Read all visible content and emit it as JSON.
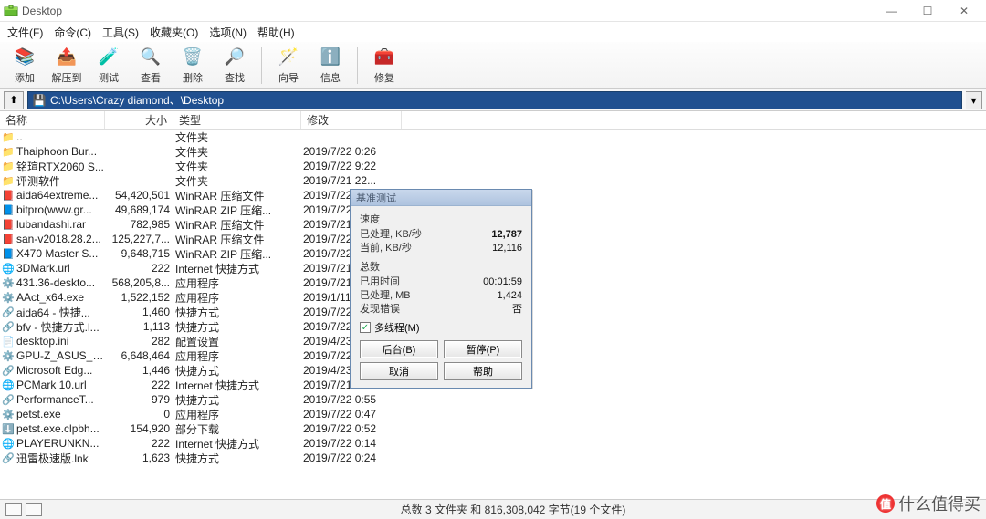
{
  "window": {
    "title": "Desktop"
  },
  "menu": {
    "file": "文件(F)",
    "cmd": "命令(C)",
    "tools": "工具(S)",
    "fav": "收藏夹(O)",
    "options": "选项(N)",
    "help": "帮助(H)"
  },
  "toolbar": {
    "add": "添加",
    "extract": "解压到",
    "test": "测试",
    "view": "查看",
    "delete": "删除",
    "find": "查找",
    "wizard": "向导",
    "info": "信息",
    "repair": "修复"
  },
  "address": {
    "path": "C:\\Users\\Crazy diamond、\\Desktop"
  },
  "columns": {
    "name": "名称",
    "size": "大小",
    "type": "类型",
    "modified": "修改"
  },
  "rows": [
    {
      "icon": "folder-up",
      "name": "..",
      "size": "",
      "type": "文件夹",
      "modified": ""
    },
    {
      "icon": "folder",
      "name": "Thaiphoon Bur...",
      "size": "",
      "type": "文件夹",
      "modified": "2019/7/22 0:26"
    },
    {
      "icon": "folder",
      "name": "铭瑄RTX2060 S...",
      "size": "",
      "type": "文件夹",
      "modified": "2019/7/22 9:22"
    },
    {
      "icon": "folder",
      "name": "评测软件",
      "size": "",
      "type": "文件夹",
      "modified": "2019/7/21 22..."
    },
    {
      "icon": "rar",
      "name": "aida64extreme...",
      "size": "54,420,501",
      "type": "WinRAR 压缩文件",
      "modified": "2019/7/22 0:32"
    },
    {
      "icon": "zip",
      "name": "bitpro(www.gr...",
      "size": "49,689,174",
      "type": "WinRAR ZIP 压缩...",
      "modified": "2019/7/22 0:59"
    },
    {
      "icon": "rar",
      "name": "lubandashi.rar",
      "size": "782,985",
      "type": "WinRAR 压缩文件",
      "modified": "2019/7/21 22..."
    },
    {
      "icon": "rar",
      "name": "san-v2018.28.2...",
      "size": "125,227,7...",
      "type": "WinRAR 压缩文件",
      "modified": "2019/7/22 0:47"
    },
    {
      "icon": "zip",
      "name": "X470 Master S...",
      "size": "9,648,715",
      "type": "WinRAR ZIP 压缩...",
      "modified": "2019/7/22 0:51"
    },
    {
      "icon": "url",
      "name": "3DMark.url",
      "size": "222",
      "type": "Internet 快捷方式",
      "modified": "2019/7/21 22..."
    },
    {
      "icon": "exe",
      "name": "431.36-deskto...",
      "size": "568,205,8...",
      "type": "应用程序",
      "modified": "2019/7/21 22..."
    },
    {
      "icon": "exe",
      "name": "AAct_x64.exe",
      "size": "1,522,152",
      "type": "应用程序",
      "modified": "2019/1/11 20..."
    },
    {
      "icon": "lnk",
      "name": "aida64 - 快捷...",
      "size": "1,460",
      "type": "快捷方式",
      "modified": "2019/7/22 20:33"
    },
    {
      "icon": "lnk",
      "name": "bfv - 快捷方式.l...",
      "size": "1,113",
      "type": "快捷方式",
      "modified": "2019/7/22 7:07"
    },
    {
      "icon": "ini",
      "name": "desktop.ini",
      "size": "282",
      "type": "配置设置",
      "modified": "2019/4/23 0:17"
    },
    {
      "icon": "exe",
      "name": "GPU-Z_ASUS_R...",
      "size": "6,648,464",
      "type": "应用程序",
      "modified": "2019/7/22 1:40"
    },
    {
      "icon": "lnk",
      "name": "Microsoft Edg...",
      "size": "1,446",
      "type": "快捷方式",
      "modified": "2019/4/23 0:18"
    },
    {
      "icon": "url",
      "name": "PCMark 10.url",
      "size": "222",
      "type": "Internet 快捷方式",
      "modified": "2019/7/21 23..."
    },
    {
      "icon": "lnk",
      "name": "PerformanceT...",
      "size": "979",
      "type": "快捷方式",
      "modified": "2019/7/22 0:55"
    },
    {
      "icon": "exe",
      "name": "petst.exe",
      "size": "0",
      "type": "应用程序",
      "modified": "2019/7/22 0:47"
    },
    {
      "icon": "part",
      "name": "petst.exe.clpbh...",
      "size": "154,920",
      "type": "部分下载",
      "modified": "2019/7/22 0:52"
    },
    {
      "icon": "url",
      "name": "PLAYERUNKN...",
      "size": "222",
      "type": "Internet 快捷方式",
      "modified": "2019/7/22 0:14"
    },
    {
      "icon": "lnk",
      "name": "迅雷极速版.lnk",
      "size": "1,623",
      "type": "快捷方式",
      "modified": "2019/7/22 0:24"
    }
  ],
  "status": {
    "text": "总数 3 文件夹 和 816,308,042 字节(19 个文件)"
  },
  "dialog": {
    "title": "基准测试",
    "speed_hd": "速度",
    "processed_kbps_lbl": "已处理, KB/秒",
    "processed_kbps_val": "12,787",
    "current_kbps_lbl": "当前, KB/秒",
    "current_kbps_val": "12,116",
    "total_hd": "总数",
    "elapsed_lbl": "已用时间",
    "elapsed_val": "00:01:59",
    "processed_mb_lbl": "已处理, MB",
    "processed_mb_val": "1,424",
    "errors_lbl": "发现错误",
    "errors_val": "否",
    "multithread": "多线程(M)",
    "btn_bg": "后台(B)",
    "btn_pause": "暂停(P)",
    "btn_cancel": "取消",
    "btn_help": "帮助"
  },
  "watermark": "什么值得买",
  "chart_data": {
    "type": "table",
    "title": "WinRAR Benchmark (基准测试)",
    "metrics": [
      {
        "label": "已处理, KB/秒",
        "value": 12787
      },
      {
        "label": "当前, KB/秒",
        "value": 12116
      },
      {
        "label": "已用时间",
        "value": "00:01:59"
      },
      {
        "label": "已处理, MB",
        "value": 1424
      },
      {
        "label": "发现错误",
        "value": 0
      }
    ],
    "multithread": true
  }
}
